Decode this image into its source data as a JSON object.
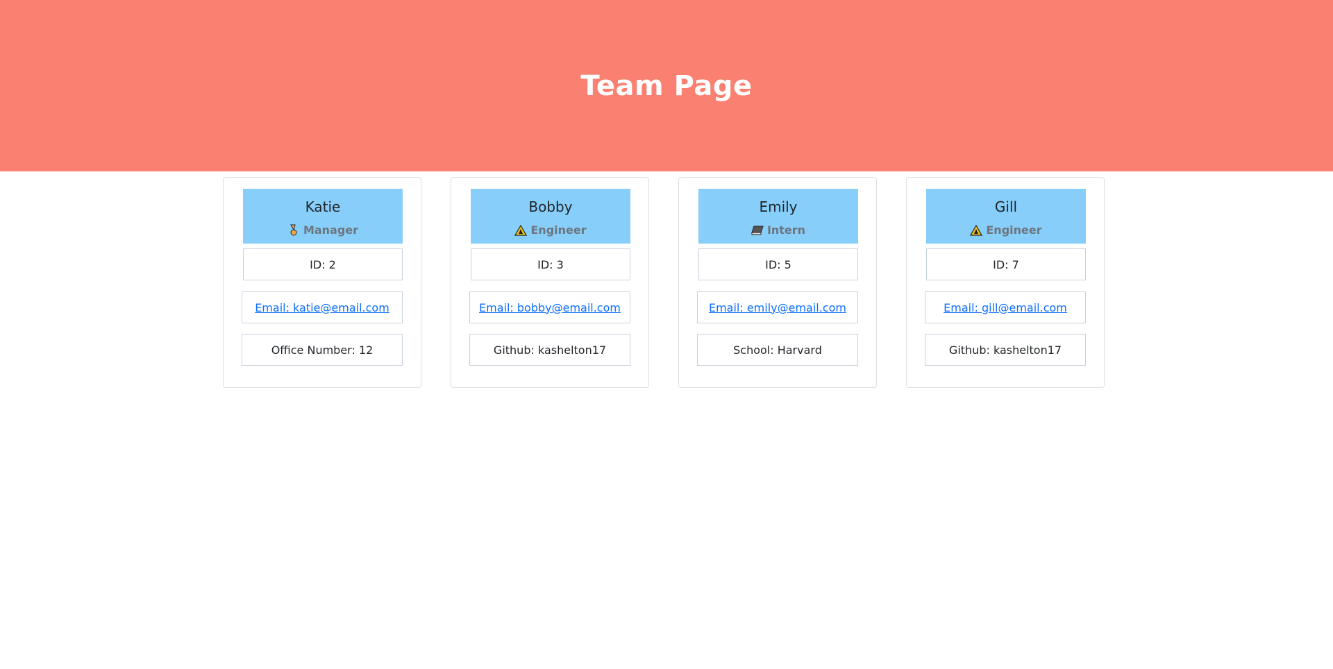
{
  "header": {
    "title": "Team Page"
  },
  "colors": {
    "header_bg": "#fa8072",
    "card_head_bg": "#87cefa",
    "link": "#0d6efd"
  },
  "members": [
    {
      "name": "Katie",
      "role": "Manager",
      "role_icon": "medal-icon",
      "id": "ID: 2",
      "email": "Email: katie@email.com",
      "extra": "Office Number: 12"
    },
    {
      "name": "Bobby",
      "role": "Engineer",
      "role_icon": "warning-cone-icon",
      "id": "ID: 3",
      "email": "Email: bobby@email.com",
      "extra": "Github: kashelton17"
    },
    {
      "name": "Emily",
      "role": "Intern",
      "role_icon": "book-icon",
      "id": "ID: 5",
      "email": "Email: emily@email.com",
      "extra": "School: Harvard"
    },
    {
      "name": "Gill",
      "role": "Engineer",
      "role_icon": "warning-cone-icon",
      "id": "ID: 7",
      "email": "Email: gill@email.com",
      "extra": "Github: kashelton17"
    }
  ]
}
